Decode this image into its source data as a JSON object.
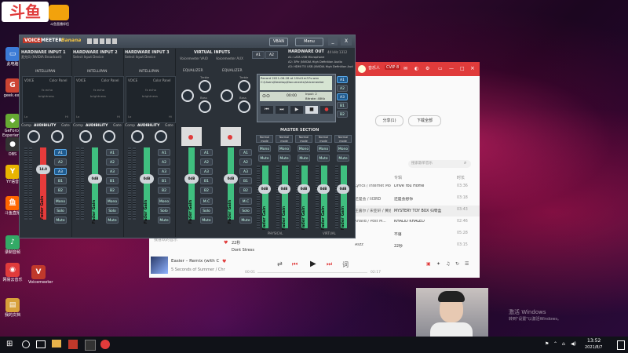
{
  "desktop": {
    "stream_logo": "斗鱼",
    "stream_badge": "斗鱼直播伴侣",
    "watermark": "激活 Windows",
    "watermark_sub": "转到\"设置\"以激活Windows。",
    "icons": [
      {
        "label": "此电脑",
        "color": "#3b7bd6",
        "glyph": "▭"
      },
      {
        "label": "geek.exe",
        "color": "#c43",
        "glyph": "G"
      },
      {
        "label": "GeForce Experience",
        "color": "#6a3",
        "glyph": "◆"
      },
      {
        "label": "OBS",
        "color": "#333",
        "glyph": "●"
      },
      {
        "label": "YY语音",
        "color": "#e8b400",
        "glyph": "Y"
      },
      {
        "label": "斗鱼直播",
        "color": "#f60",
        "glyph": "鱼"
      },
      {
        "label": "录制音频",
        "color": "#3a6",
        "glyph": "♪"
      },
      {
        "label": "网易云音乐",
        "color": "#e03b3b",
        "glyph": "◉"
      },
      {
        "label": "Voicemeeter",
        "color": "#c0392b",
        "glyph": "V"
      },
      {
        "label": "我的文档",
        "color": "#d8a13a",
        "glyph": "▤"
      }
    ]
  },
  "voicemeeter": {
    "brand_voice": "VOICE",
    "brand_meeter": "MEETER",
    "brand_edition": "Banana",
    "vban": "VBAN",
    "menu": "Menu",
    "win_min": "_",
    "win_close": "X",
    "inputs": [
      {
        "title": "HARDWARE INPUT 1",
        "device": "麦克风 (NVIDIA Broadcast)",
        "intelli": "INTELLIPAN",
        "voice": "VOICE",
        "color_panel": "Color Panel",
        "fx_echo": "fx echo",
        "brightness": "brightness",
        "lo": "Lo",
        "hi": "Hi",
        "comp": "Comp",
        "audibility": "AUDIBILITY",
        "gate": "Gate",
        "gain": "14.0",
        "fader_label": "Fader Gain",
        "buses": [
          "A1",
          "A2",
          "A3",
          "B1",
          "B2"
        ],
        "mono": "Mono",
        "solo": "Solo",
        "mute": "Mute",
        "a_on": [
          true,
          false,
          true
        ],
        "b_on": [
          false,
          false
        ]
      },
      {
        "title": "HARDWARE INPUT 2",
        "device": "Select Input Device",
        "intelli": "INTELLIPAN",
        "voice": "VOICE",
        "color_panel": "Color Panel",
        "fx_echo": "fx echo",
        "brightness": "brightness",
        "lo": "Lo",
        "hi": "Hi",
        "comp": "Comp",
        "audibility": "AUDIBILITY",
        "gate": "Gate",
        "gain": "0dB",
        "fader_label": "Fader Gain",
        "buses": [
          "A1",
          "A2",
          "A3",
          "B1",
          "B2"
        ],
        "mono": "Mono",
        "solo": "Solo",
        "mute": "Mute",
        "a_on": [
          false,
          false,
          false
        ],
        "b_on": [
          false,
          false
        ]
      },
      {
        "title": "HARDWARE INPUT 3",
        "device": "Select Input Device",
        "intelli": "INTELLIPAN",
        "voice": "VOICE",
        "color_panel": "Color Panel",
        "fx_echo": "fx echo",
        "brightness": "brightness",
        "lo": "Lo",
        "hi": "Hi",
        "comp": "Comp",
        "audibility": "AUDIBILITY",
        "gate": "Gate",
        "gain": "0dB",
        "fader_label": "Fader Gain",
        "buses": [
          "A1",
          "A2",
          "A3",
          "B1",
          "B2"
        ],
        "mono": "Mono",
        "solo": "Solo",
        "mute": "Mute",
        "a_on": [
          false,
          false,
          false
        ],
        "b_on": [
          false,
          false
        ]
      }
    ],
    "virtual": {
      "title": "VIRTUAL INPUTS",
      "devices": [
        "Voicemeeter VAIO",
        "Voicemeeter AUX"
      ],
      "equalizer": "EQUALIZER",
      "treble": "Treble",
      "bass": "Bass",
      "gains": [
        "0dB",
        "0dB"
      ],
      "fader_label": "Fader Gain",
      "buses": [
        "A1",
        "A2",
        "A3",
        "B1",
        "B2"
      ],
      "mc": "M.C",
      "solo": "Solo",
      "mute": "Mute"
    },
    "hw_out": {
      "title": "HARDWARE OUT",
      "meta": "44 kHz 1312",
      "devices": [
        "A1: LATA USB Microphone",
        "A2: 3Ptr (NVIDIA High Definition Audio",
        "A3: HDMI TO USB (NVIDIA High Definition Aud"
      ],
      "buses": [
        "A1",
        "A2",
        "A3",
        "B1",
        "B2"
      ]
    },
    "recorder": {
      "title": "Record 2021-06-28 at 19h41m37s.wav",
      "path": "C:\\Users\\Desktop\\Documents\\Voicemeeter",
      "time": "00:00",
      "input": "Input: 2",
      "bitrate": "Bitrate: 48Kb"
    },
    "master": {
      "title": "MASTER SECTION",
      "channels": [
        {
          "mode": "Normal mode",
          "gain": "0dB",
          "label": "Fader Gain",
          "mono": "Mono",
          "mute": "Mute"
        },
        {
          "mode": "Normal mode",
          "gain": "0dB",
          "label": "Fader Gain",
          "mono": "Mono",
          "mute": "Mute"
        },
        {
          "mode": "Normal mode",
          "gain": "0dB",
          "label": "Fader Gain",
          "mono": "Mono",
          "mute": "Mute"
        },
        {
          "mode": "Normal mode",
          "gain": "0dB",
          "label": "Fader Gain",
          "mono": "Mono",
          "mute": "Mute"
        },
        {
          "mode": "Normal mode",
          "gain": "0dB",
          "label": "Fader Gain",
          "mono": "Mono",
          "mute": "Mute"
        }
      ],
      "physical": "PHYSICAL",
      "virtual": "VIRTUAL"
    }
  },
  "music": {
    "user": "音乐人",
    "vip": "CVIP 8",
    "share_label": "分享(1)",
    "download_label": "下载全部",
    "search_placeholder": "搜索歌单音乐",
    "col_album": "专辑",
    "col_time": "时长",
    "rows": [
      {
        "artist": "Lyrics / Internet Mo...",
        "album": "Drive You Home",
        "time": "03:36"
      },
      {
        "artist": "还是会 / lil3RD",
        "album": "还是会想你",
        "time": "03:18"
      },
      {
        "artist": "王嘉尔 / 宋亚轩 / 黄旭熙",
        "album": "MYSTERY TOY BOX 归零盒",
        "time": "03:43"
      },
      {
        "artist": "Khalid / Post M...",
        "album": "KHALID KHALED",
        "time": "02:46"
      },
      {
        "artist": "",
        "album": "不语",
        "time": "05:28"
      },
      {
        "artist": "Aszz",
        "album": "22秒",
        "time": "03:15"
      },
      {
        "artist": "MARUV / Drover",
        "album": "Eng in Mykonos 2016",
        "time": "03:04"
      }
    ],
    "my_liked": "我喜欢的音乐",
    "song_title": "Easier – Remix (with C",
    "song_artist": "5 Seconds of Summer / Chr",
    "t_now": "00:01",
    "t_total": "02:17",
    "partial_song": "22秒",
    "partial_song2": "Dont Stress"
  },
  "taskbar": {
    "time": "13:52",
    "date": "2021/8/7"
  }
}
